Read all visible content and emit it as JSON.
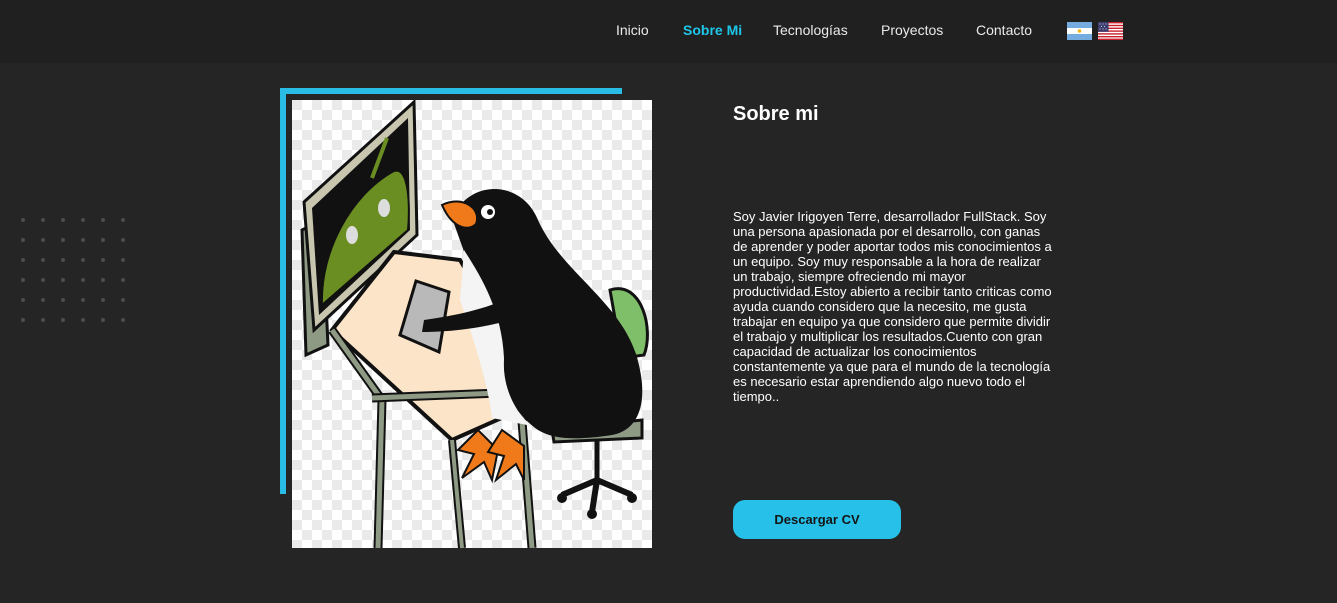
{
  "nav": {
    "items": [
      {
        "label": "Inicio",
        "active": false
      },
      {
        "label": "Sobre Mi",
        "active": true
      },
      {
        "label": "Tecnologías",
        "active": false
      },
      {
        "label": "Proyectos",
        "active": false
      },
      {
        "label": "Contacto",
        "active": false
      }
    ],
    "flags": [
      {
        "icon": "argentina-flag-icon",
        "language": "es"
      },
      {
        "icon": "usa-flag-icon",
        "language": "en"
      }
    ]
  },
  "about": {
    "title": "Sobre mi",
    "text": "Soy Javier Irigoyen Terre, desarrollador FullStack. Soy una persona apasionada por el desarrollo, con ganas de aprender y poder aportar todos mis conocimientos a un equipo. Soy muy responsable a la hora de realizar un trabajo, siempre ofreciendo mi mayor productividad.Estoy abierto a recibir tanto criticas como ayuda cuando considero que la necesito, me gusta trabajar en equipo ya que considero que permite dividir el trabajo y multiplicar los resultados.Cuento con gran capacidad de actualizar los conocimientos constantemente ya que para el mundo de la tecnología es necesario estar aprendiendo algo nuevo todo el tiempo..",
    "cv_button": "Descargar CV",
    "image_icon": "penguin-at-computer-illustration"
  },
  "colors": {
    "background": "#252525",
    "navbar": "#202020",
    "accent": "#1ec6e9",
    "button": "#26c0e8"
  }
}
